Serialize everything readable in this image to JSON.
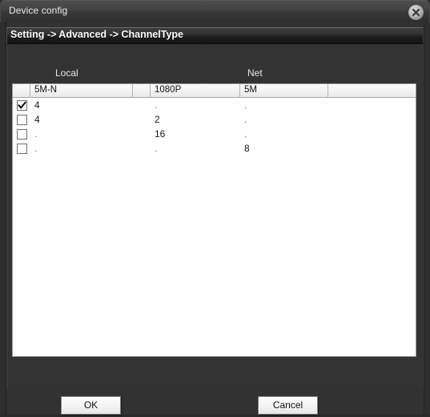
{
  "window": {
    "title": "Device config",
    "close_icon": "close-circle-icon"
  },
  "breadcrumb": {
    "text": "Setting -> Advanced -> ChannelType"
  },
  "groups": {
    "local_label": "Local",
    "net_label": "Net"
  },
  "table": {
    "headers": [
      "",
      "5M-N",
      "",
      "1080P",
      "5M",
      ""
    ],
    "rows": [
      {
        "checked": true,
        "local1": "4",
        "local2": ".",
        "net1": ".",
        "net2": ""
      },
      {
        "checked": false,
        "local1": "4",
        "local2": "2",
        "net1": ".",
        "net2": ""
      },
      {
        "checked": false,
        "local1": ".",
        "local2": "16",
        "net1": ".",
        "net2": ""
      },
      {
        "checked": false,
        "local1": ".",
        "local2": ".",
        "net1": "8",
        "net2": ""
      }
    ]
  },
  "footer": {
    "ok_label": "OK",
    "cancel_label": "Cancel"
  },
  "colors": {
    "window_bg": "#323232",
    "titlebar": "#434343",
    "table_bg": "#ffffff",
    "header_bg": "#f0f0f0",
    "text_light": "#e8e8e8"
  }
}
